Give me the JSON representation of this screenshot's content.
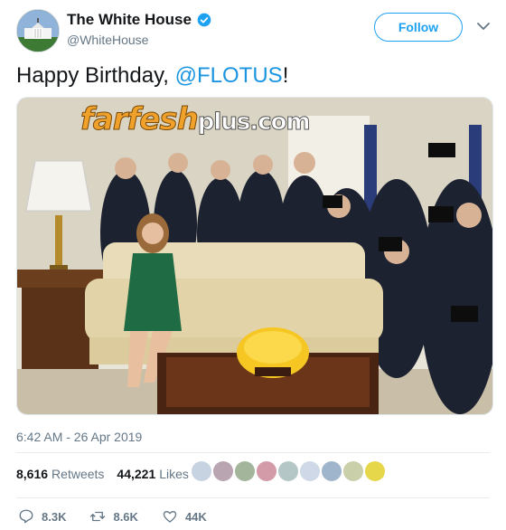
{
  "user": {
    "display_name": "The White House",
    "handle": "@WhiteHouse",
    "verified": true,
    "avatar_icon": "white-house-building-icon"
  },
  "follow_label": "Follow",
  "tweet": {
    "text_before": "Happy Birthday, ",
    "mention": "@FLOTUS",
    "text_after": "!",
    "mention_color": "#1b95e0"
  },
  "media": {
    "watermark_primary": "farfesh",
    "watermark_secondary": "plus.com"
  },
  "timestamp": "6:42 AM - 26 Apr 2019",
  "stats": {
    "retweets_count": "8,616",
    "retweets_label": "Retweets",
    "likes_count": "44,221",
    "likes_label": "Likes"
  },
  "actions": {
    "replies": "8.3K",
    "retweets": "8.6K",
    "likes": "44K"
  },
  "colors": {
    "accent": "#1da1f2",
    "muted": "#657786",
    "like_red": "#e0245e"
  }
}
